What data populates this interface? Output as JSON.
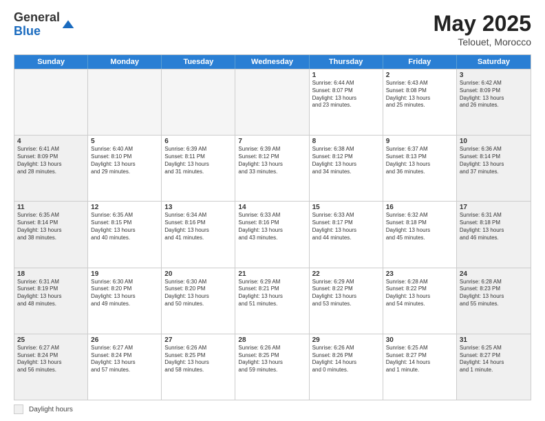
{
  "header": {
    "logo_line1": "General",
    "logo_line2": "Blue",
    "month_year": "May 2025",
    "location": "Telouet, Morocco"
  },
  "day_headers": [
    "Sunday",
    "Monday",
    "Tuesday",
    "Wednesday",
    "Thursday",
    "Friday",
    "Saturday"
  ],
  "weeks": [
    [
      {
        "num": "",
        "info": "",
        "empty": true
      },
      {
        "num": "",
        "info": "",
        "empty": true
      },
      {
        "num": "",
        "info": "",
        "empty": true
      },
      {
        "num": "",
        "info": "",
        "empty": true
      },
      {
        "num": "1",
        "info": "Sunrise: 6:44 AM\nSunset: 8:07 PM\nDaylight: 13 hours\nand 23 minutes.",
        "empty": false
      },
      {
        "num": "2",
        "info": "Sunrise: 6:43 AM\nSunset: 8:08 PM\nDaylight: 13 hours\nand 25 minutes.",
        "empty": false
      },
      {
        "num": "3",
        "info": "Sunrise: 6:42 AM\nSunset: 8:09 PM\nDaylight: 13 hours\nand 26 minutes.",
        "empty": false
      }
    ],
    [
      {
        "num": "4",
        "info": "Sunrise: 6:41 AM\nSunset: 8:09 PM\nDaylight: 13 hours\nand 28 minutes.",
        "empty": false
      },
      {
        "num": "5",
        "info": "Sunrise: 6:40 AM\nSunset: 8:10 PM\nDaylight: 13 hours\nand 29 minutes.",
        "empty": false
      },
      {
        "num": "6",
        "info": "Sunrise: 6:39 AM\nSunset: 8:11 PM\nDaylight: 13 hours\nand 31 minutes.",
        "empty": false
      },
      {
        "num": "7",
        "info": "Sunrise: 6:39 AM\nSunset: 8:12 PM\nDaylight: 13 hours\nand 33 minutes.",
        "empty": false
      },
      {
        "num": "8",
        "info": "Sunrise: 6:38 AM\nSunset: 8:12 PM\nDaylight: 13 hours\nand 34 minutes.",
        "empty": false
      },
      {
        "num": "9",
        "info": "Sunrise: 6:37 AM\nSunset: 8:13 PM\nDaylight: 13 hours\nand 36 minutes.",
        "empty": false
      },
      {
        "num": "10",
        "info": "Sunrise: 6:36 AM\nSunset: 8:14 PM\nDaylight: 13 hours\nand 37 minutes.",
        "empty": false
      }
    ],
    [
      {
        "num": "11",
        "info": "Sunrise: 6:35 AM\nSunset: 8:14 PM\nDaylight: 13 hours\nand 38 minutes.",
        "empty": false
      },
      {
        "num": "12",
        "info": "Sunrise: 6:35 AM\nSunset: 8:15 PM\nDaylight: 13 hours\nand 40 minutes.",
        "empty": false
      },
      {
        "num": "13",
        "info": "Sunrise: 6:34 AM\nSunset: 8:16 PM\nDaylight: 13 hours\nand 41 minutes.",
        "empty": false
      },
      {
        "num": "14",
        "info": "Sunrise: 6:33 AM\nSunset: 8:16 PM\nDaylight: 13 hours\nand 43 minutes.",
        "empty": false
      },
      {
        "num": "15",
        "info": "Sunrise: 6:33 AM\nSunset: 8:17 PM\nDaylight: 13 hours\nand 44 minutes.",
        "empty": false
      },
      {
        "num": "16",
        "info": "Sunrise: 6:32 AM\nSunset: 8:18 PM\nDaylight: 13 hours\nand 45 minutes.",
        "empty": false
      },
      {
        "num": "17",
        "info": "Sunrise: 6:31 AM\nSunset: 8:18 PM\nDaylight: 13 hours\nand 46 minutes.",
        "empty": false
      }
    ],
    [
      {
        "num": "18",
        "info": "Sunrise: 6:31 AM\nSunset: 8:19 PM\nDaylight: 13 hours\nand 48 minutes.",
        "empty": false
      },
      {
        "num": "19",
        "info": "Sunrise: 6:30 AM\nSunset: 8:20 PM\nDaylight: 13 hours\nand 49 minutes.",
        "empty": false
      },
      {
        "num": "20",
        "info": "Sunrise: 6:30 AM\nSunset: 8:20 PM\nDaylight: 13 hours\nand 50 minutes.",
        "empty": false
      },
      {
        "num": "21",
        "info": "Sunrise: 6:29 AM\nSunset: 8:21 PM\nDaylight: 13 hours\nand 51 minutes.",
        "empty": false
      },
      {
        "num": "22",
        "info": "Sunrise: 6:29 AM\nSunset: 8:22 PM\nDaylight: 13 hours\nand 53 minutes.",
        "empty": false
      },
      {
        "num": "23",
        "info": "Sunrise: 6:28 AM\nSunset: 8:22 PM\nDaylight: 13 hours\nand 54 minutes.",
        "empty": false
      },
      {
        "num": "24",
        "info": "Sunrise: 6:28 AM\nSunset: 8:23 PM\nDaylight: 13 hours\nand 55 minutes.",
        "empty": false
      }
    ],
    [
      {
        "num": "25",
        "info": "Sunrise: 6:27 AM\nSunset: 8:24 PM\nDaylight: 13 hours\nand 56 minutes.",
        "empty": false
      },
      {
        "num": "26",
        "info": "Sunrise: 6:27 AM\nSunset: 8:24 PM\nDaylight: 13 hours\nand 57 minutes.",
        "empty": false
      },
      {
        "num": "27",
        "info": "Sunrise: 6:26 AM\nSunset: 8:25 PM\nDaylight: 13 hours\nand 58 minutes.",
        "empty": false
      },
      {
        "num": "28",
        "info": "Sunrise: 6:26 AM\nSunset: 8:25 PM\nDaylight: 13 hours\nand 59 minutes.",
        "empty": false
      },
      {
        "num": "29",
        "info": "Sunrise: 6:26 AM\nSunset: 8:26 PM\nDaylight: 14 hours\nand 0 minutes.",
        "empty": false
      },
      {
        "num": "30",
        "info": "Sunrise: 6:25 AM\nSunset: 8:27 PM\nDaylight: 14 hours\nand 1 minute.",
        "empty": false
      },
      {
        "num": "31",
        "info": "Sunrise: 6:25 AM\nSunset: 8:27 PM\nDaylight: 14 hours\nand 1 minute.",
        "empty": false
      }
    ]
  ],
  "legend": {
    "shaded_label": "Daylight hours"
  }
}
